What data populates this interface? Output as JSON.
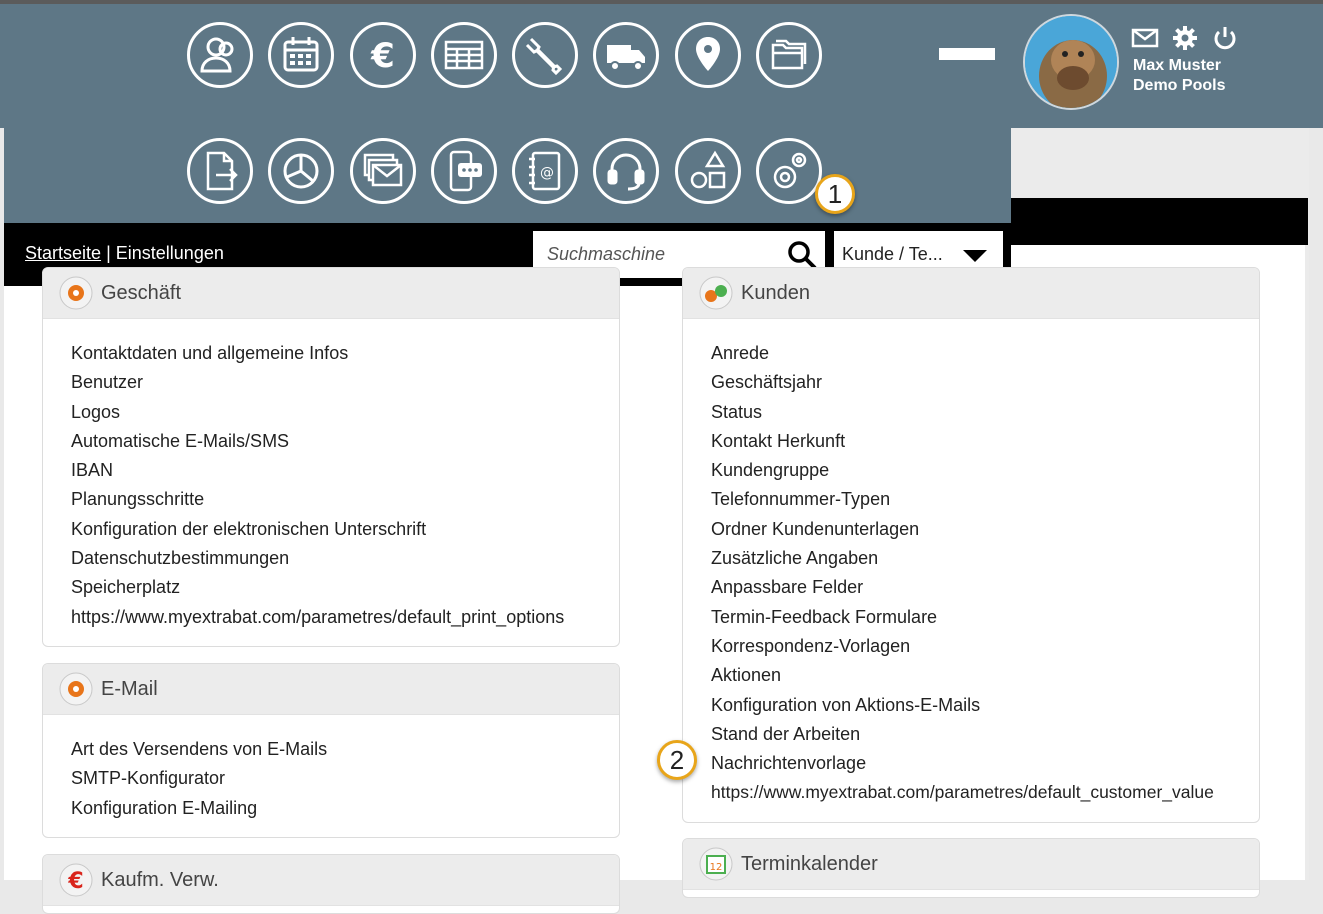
{
  "header": {
    "row1_icons": [
      "contacts-icon",
      "calendar-icon",
      "euro-icon",
      "spreadsheet-icon",
      "wrench-icon",
      "truck-icon",
      "location-pin-icon",
      "folders-icon"
    ],
    "row2_icons": [
      "document-export-icon",
      "pie-chart-icon",
      "mail-stack-icon",
      "phone-chat-icon",
      "address-book-icon",
      "headset-icon",
      "shapes-icon",
      "settings-gears-icon"
    ],
    "user": {
      "name": "Max Muster",
      "company": "Demo Pools"
    },
    "badges": [
      "1",
      "2"
    ]
  },
  "nav": {
    "breadcrumb_home": "Startseite",
    "breadcrumb_sep": "|",
    "breadcrumb_current": "Einstellungen",
    "search_placeholder": "Suchmaschine",
    "select_value": "Kunde / Te..."
  },
  "panels": {
    "geschaeft": {
      "title": "Geschäft",
      "items": [
        "Kontaktdaten und allgemeine Infos",
        "Benutzer",
        "Logos",
        "Automatische E-Mails/SMS",
        "IBAN",
        "Planungsschritte",
        "Konfiguration der elektronischen Unterschrift",
        "Datenschutzbestimmungen",
        "Speicherplatz",
        "https://www.myextrabat.com/parametres/default_print_options"
      ]
    },
    "email": {
      "title": "E-Mail",
      "items": [
        "Art des Versendens von E-Mails",
        "SMTP-Konfigurator",
        "Konfiguration E-Mailing"
      ]
    },
    "kaufm": {
      "title": "Kaufm. Verw."
    },
    "kunden": {
      "title": "Kunden",
      "items": [
        "Anrede",
        "Geschäftsjahr",
        "Status",
        "Kontakt Herkunft",
        "Kundengruppe",
        "Telefonnummer-Typen",
        "Ordner Kundenunterlagen",
        "Zusätzliche Angaben",
        "Anpassbare Felder",
        "Termin-Feedback Formulare",
        "Korrespondenz-Vorlagen",
        "Aktionen",
        "Konfiguration von Aktions-E-Mails",
        "Stand der Arbeiten",
        "Nachrichtenvorlage",
        "https://www.myextrabat.com/parametres/default_customer_value"
      ]
    },
    "termin": {
      "title": "Terminkalender"
    }
  },
  "colors": {
    "header": "#5e7786",
    "badge_border": "#e8a51a"
  }
}
